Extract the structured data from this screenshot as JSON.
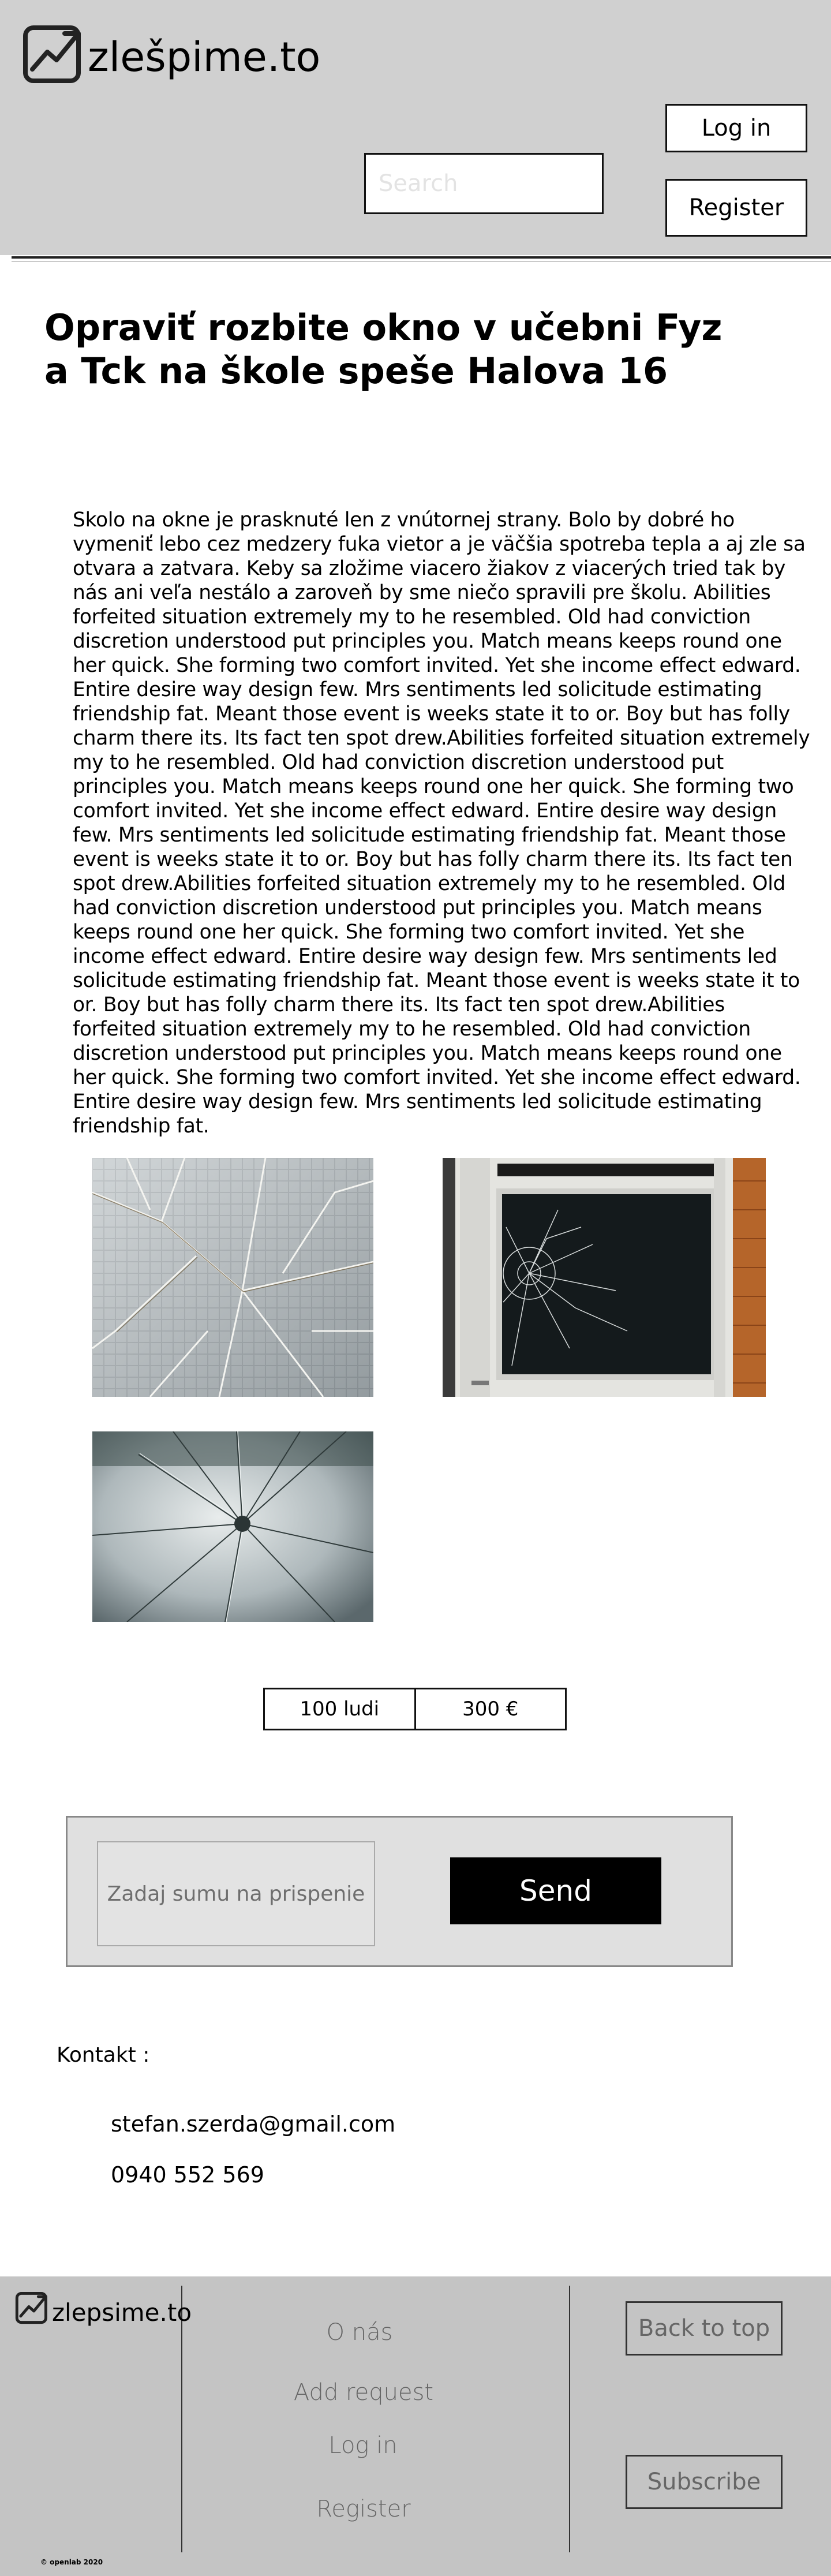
{
  "header": {
    "logo_text": "zlešpime.to",
    "login_label": "Log in",
    "register_label": "Register",
    "search_placeholder": "Search"
  },
  "main": {
    "title": "Opraviť rozbite okno v učebni Fyz a Tck na škole speše Halova 16",
    "description": "Skolo  na okne je prasknuté len z vnútornej strany. Bolo by dobré ho vymeniť lebo cez medzery fuka vietor a je väčšia spotreba tepla a aj zle sa otvara a zatvara. Keby sa zložime viacero žiakov z viacerých tried tak by nás ani veľa nestálo a zaroveň by sme niečo spravili pre školu. Abilities forfeited situation extremely my to he resembled. Old had conviction discretion understood put principles you. Match means keeps round one her quick. She forming two comfort invited. Yet she income effect edward. Entire desire way design few. Mrs sentiments led solicitude estimating friendship fat. Meant those event is weeks state it to or. Boy but has folly charm there its. Its fact ten spot drew.Abilities forfeited situation extremely my to he resembled. Old had conviction discretion understood put principles you. Match means keeps round one her quick. She forming two comfort invited. Yet she income effect edward. Entire desire way design few. Mrs sentiments led solicitude estimating friendship fat. Meant those event is weeks state it to or. Boy but has folly charm there its. Its fact ten spot drew.Abilities forfeited situation extremely my to he resembled. Old had conviction discretion understood put principles you. Match means keeps round one her quick. She forming two comfort invited. Yet she income effect edward. Entire desire way design few. Mrs sentiments led solicitude estimating friendship fat. Meant those event is weeks state it to or. Boy but has folly charm there its. Its fact ten spot drew.Abilities forfeited situation extremely my to he resembled. Old had conviction discretion understood put principles you. Match means keeps round one her quick. She forming two comfort invited. Yet she income effect edward. Entire desire way design few. Mrs sentiments led solicitude estimating friendship fat.",
    "images": [
      "cracked-wired-glass-photo",
      "broken-window-frame-photo",
      "shattered-glass-closeup-photo"
    ],
    "stats": {
      "people": "100 ludi",
      "amount": "300 €"
    }
  },
  "donate": {
    "placeholder": "Zadaj sumu na prispenie",
    "send_label": "Send"
  },
  "contact": {
    "label": "Kontakt :",
    "email": "stefan.szerda@gmail.com",
    "phone": "0940 552 569"
  },
  "footer": {
    "logo_text": "zlepsime.to",
    "links": [
      "O nás",
      "Add request",
      "Log in",
      "Register"
    ],
    "back_to_top": "Back to top",
    "subscribe": "Subscribe",
    "copyright": "© openlab 2020"
  },
  "colors": {
    "header_bg": "#d0d0d0",
    "footer_bg": "#c4c4c4",
    "send_bg": "#000000",
    "donate_bg": "#e0e0e0"
  }
}
